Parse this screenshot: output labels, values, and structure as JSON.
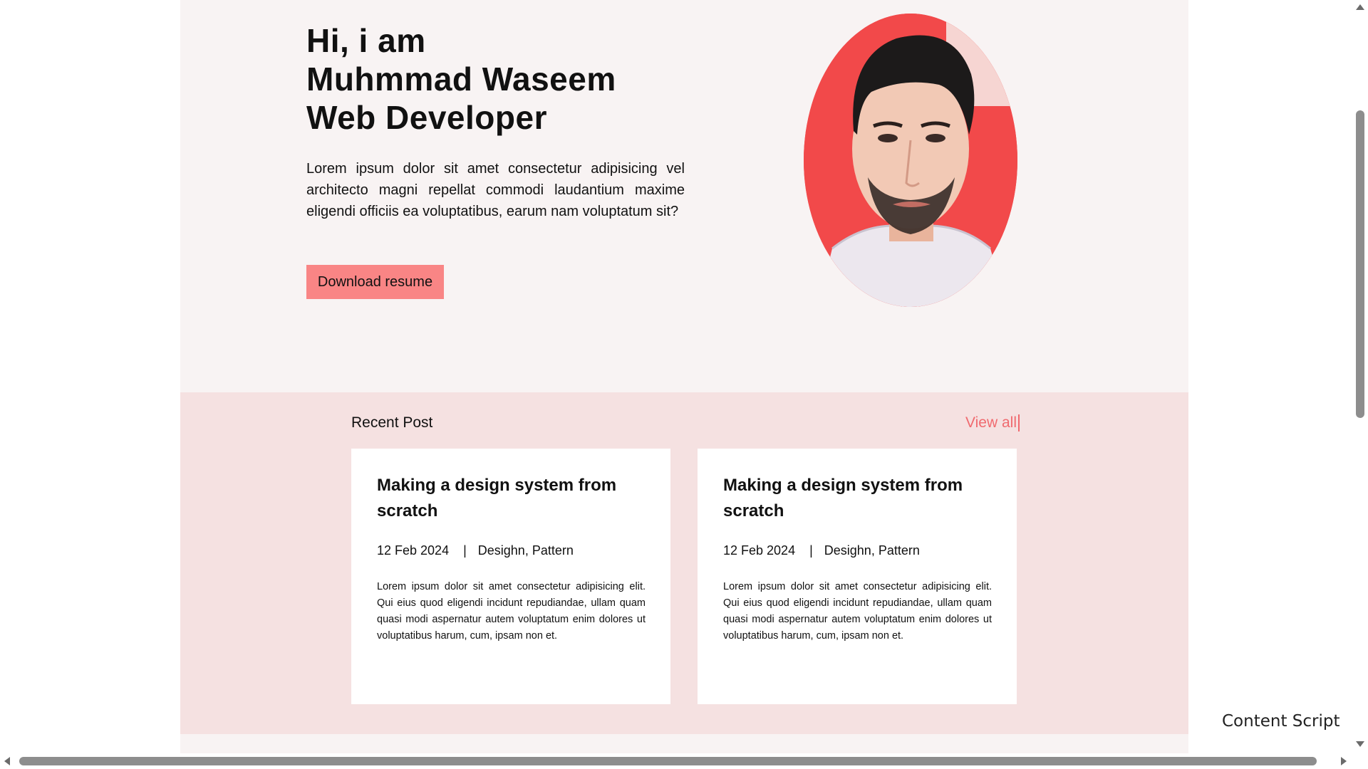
{
  "hero": {
    "title_line1": "Hi, i am",
    "title_line2": "Muhmmad Waseem",
    "title_line3": "Web Developer",
    "intro": "Lorem ipsum dolor sit amet consectetur adipisicing vel architecto magni repellat commodi laudantium maxime eligendi officiis ea voluptatibus, earum nam voluptatum sit?",
    "button_label": "Download resume",
    "portrait_bg_color": "#f2494a"
  },
  "posts": {
    "heading": "Recent Post",
    "view_all_label": "View all",
    "items": [
      {
        "title": "Making a design system from scratch",
        "date": "12 Feb 2024",
        "separator": "|",
        "tags": "Desighn, Pattern",
        "excerpt": "Lorem ipsum dolor sit amet consectetur adipisicing elit. Qui eius quod eligendi incidunt repudiandae, ullam quam quasi modi aspernatur autem voluptatum enim dolores ut voluptatibus harum, cum, ipsam non et."
      },
      {
        "title": "Making a design system from scratch",
        "date": "12 Feb 2024",
        "separator": "|",
        "tags": "Desighn, Pattern",
        "excerpt": "Lorem ipsum dolor sit amet consectetur adipisicing elit. Qui eius quod eligendi incidunt repudiandae, ullam quam quasi modi aspernatur autem voluptatum enim dolores ut voluptatibus harum, cum, ipsam non et."
      }
    ]
  },
  "overlay": {
    "content_script_label": "Content Script"
  },
  "colors": {
    "accent": "#f98585",
    "link": "#f06a6f",
    "hero_bg": "#f8f3f3",
    "posts_bg": "#f5e1e1"
  }
}
